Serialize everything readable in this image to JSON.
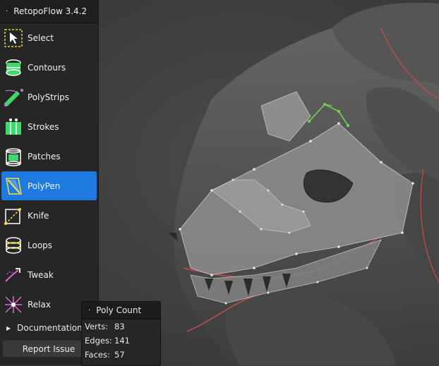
{
  "app": {
    "title": "RetopoFlow 3.4.2"
  },
  "tools": [
    {
      "id": "select",
      "label": "Select",
      "icon": "select-arrow-icon"
    },
    {
      "id": "contours",
      "label": "Contours",
      "icon": "contours-icon"
    },
    {
      "id": "polystrips",
      "label": "PolyStrips",
      "icon": "polystrips-icon"
    },
    {
      "id": "strokes",
      "label": "Strokes",
      "icon": "strokes-icon"
    },
    {
      "id": "patches",
      "label": "Patches",
      "icon": "patches-icon"
    },
    {
      "id": "polypen",
      "label": "PolyPen",
      "icon": "polypen-icon",
      "active": true
    },
    {
      "id": "knife",
      "label": "Knife",
      "icon": "knife-icon"
    },
    {
      "id": "loops",
      "label": "Loops",
      "icon": "loops-icon"
    },
    {
      "id": "tweak",
      "label": "Tweak",
      "icon": "tweak-icon"
    },
    {
      "id": "relax",
      "label": "Relax",
      "icon": "relax-icon"
    }
  ],
  "documentation": {
    "label": "Documentation"
  },
  "report": {
    "label": "Report Issue"
  },
  "poly_count": {
    "title": "Poly Count",
    "verts_label": "Verts:",
    "verts": "83",
    "edges_label": "Edges:",
    "edges": "141",
    "faces_label": "Faces:",
    "faces": "57"
  },
  "colors": {
    "accent": "#1f7ae0",
    "panel": "#262626",
    "mesh_highlight": "#6fdc4a",
    "outline": "#c0504d"
  }
}
